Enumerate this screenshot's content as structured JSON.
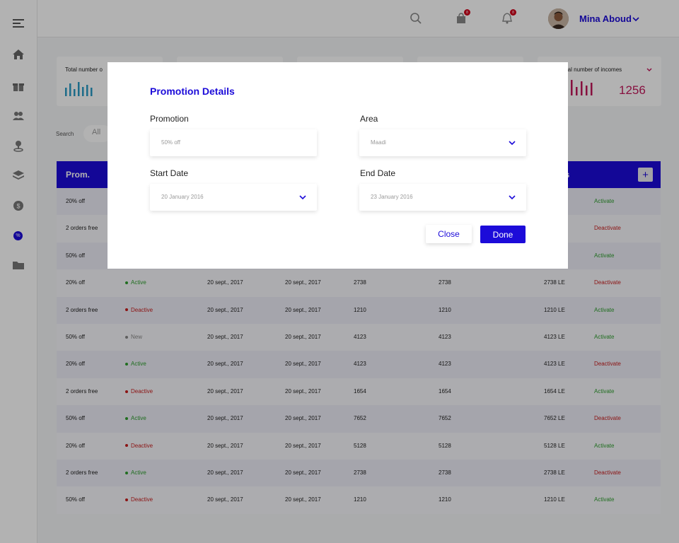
{
  "topbar": {
    "user_name": "Mina Aboud",
    "cart_badge": "8",
    "bell_badge": "8"
  },
  "sidebar": {
    "items": [
      "menu-icon",
      "home-icon",
      "gift-icon",
      "users-icon",
      "location-icon",
      "layers-icon",
      "money-icon",
      "percent-icon",
      "folder-icon"
    ],
    "active_glyph": "%"
  },
  "stats": {
    "left_title": "Total number o",
    "right_title": "otal number of incomes",
    "right_value": "1256"
  },
  "search": {
    "label": "Search",
    "filter": "All"
  },
  "table": {
    "header_first": "Prom.",
    "header_last": "es",
    "add_label": "+",
    "rows": [
      {
        "name": "20% off",
        "status": "",
        "status_color": "",
        "start": "",
        "end": "",
        "q1": "",
        "q2": "",
        "amount": "",
        "action": "Activate",
        "action_color": "#2e9e2e"
      },
      {
        "name": "2 orders free",
        "status": "",
        "status_color": "",
        "start": "",
        "end": "",
        "q1": "",
        "q2": "",
        "amount": "",
        "action": "Deactivate",
        "action_color": "#c81e1e"
      },
      {
        "name": "50% off",
        "status": "",
        "status_color": "",
        "start": "",
        "end": "",
        "q1": "",
        "q2": "",
        "amount": "",
        "action": "Activate",
        "action_color": "#2e9e2e"
      },
      {
        "name": "20% off",
        "status": "Active",
        "status_color": "#2e9e2e",
        "start": "20 sept., 2017",
        "end": "20 sept., 2017",
        "q1": "2738",
        "q2": "2738",
        "amount": "2738 LE",
        "action": "Deactivate",
        "action_color": "#c81e1e"
      },
      {
        "name": "2 orders free",
        "status": "Deactive",
        "status_color": "#c81e1e",
        "start": "20 sept., 2017",
        "end": "20 sept., 2017",
        "q1": "1210",
        "q2": "1210",
        "amount": "1210 LE",
        "action": "Activate",
        "action_color": "#2e9e2e"
      },
      {
        "name": "50% off",
        "status": "New",
        "status_color": "#888888",
        "start": "20 sept., 2017",
        "end": "20 sept., 2017",
        "q1": "4123",
        "q2": "4123",
        "amount": "4123 LE",
        "action": "Activate",
        "action_color": "#2e9e2e"
      },
      {
        "name": "20% off",
        "status": "Active",
        "status_color": "#2e9e2e",
        "start": "20 sept., 2017",
        "end": "20 sept., 2017",
        "q1": "4123",
        "q2": "4123",
        "amount": "4123 LE",
        "action": "Deactivate",
        "action_color": "#c81e1e"
      },
      {
        "name": "2 orders free",
        "status": "Deactive",
        "status_color": "#c81e1e",
        "start": "20 sept., 2017",
        "end": "20 sept., 2017",
        "q1": "1654",
        "q2": "1654",
        "amount": "1654 LE",
        "action": "Activate",
        "action_color": "#2e9e2e"
      },
      {
        "name": "50% off",
        "status": "Active",
        "status_color": "#2e9e2e",
        "start": "20 sept., 2017",
        "end": "20 sept., 2017",
        "q1": "7652",
        "q2": "7652",
        "amount": "7652 LE",
        "action": "Deactivate",
        "action_color": "#c81e1e"
      },
      {
        "name": "20% off",
        "status": "Deactive",
        "status_color": "#c81e1e",
        "start": "20 sept., 2017",
        "end": "20 sept., 2017",
        "q1": "5128",
        "q2": "5128",
        "amount": "5128 LE",
        "action": "Activate",
        "action_color": "#2e9e2e"
      },
      {
        "name": "2 orders free",
        "status": "Active",
        "status_color": "#2e9e2e",
        "start": "20 sept., 2017",
        "end": "20 sept., 2017",
        "q1": "2738",
        "q2": "2738",
        "amount": "2738 LE",
        "action": "Deactivate",
        "action_color": "#c81e1e"
      },
      {
        "name": "50% off",
        "status": "Deactive",
        "status_color": "#c81e1e",
        "start": "20 sept., 2017",
        "end": "20 sept., 2017",
        "q1": "1210",
        "q2": "1210",
        "amount": "1210 LE",
        "action": "Activate",
        "action_color": "#2e9e2e"
      }
    ]
  },
  "modal": {
    "title": "Promotion Details",
    "promotion_label": "Promotion",
    "promotion_value": "50% off",
    "area_label": "Area",
    "area_value": "Maadi",
    "start_label": "Start Date",
    "start_value": "20 January 2016",
    "end_label": "End Date",
    "end_value": "23 January 2016",
    "close_label": "Close",
    "done_label": "Done"
  },
  "colors": {
    "accent": "#1c0bd9",
    "chart_teal": "#2a9bc4",
    "chart_pink": "#c2185b"
  }
}
